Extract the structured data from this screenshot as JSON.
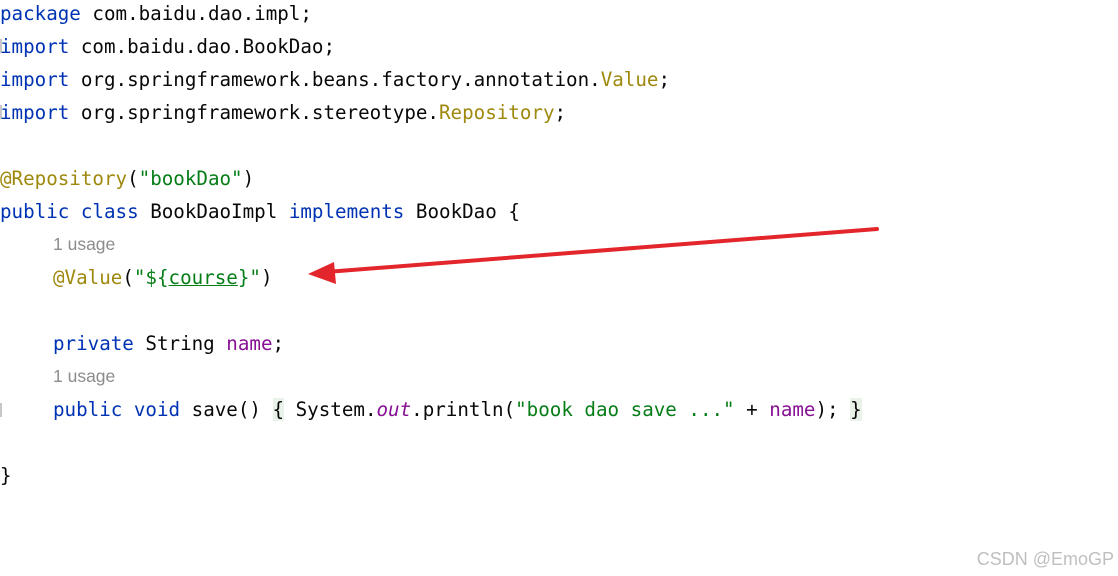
{
  "code": {
    "package_kw": "package",
    "package_name": " com.baidu.dao.impl;",
    "imports": [
      {
        "kw": "import",
        "path": " com.baidu.dao.BookDao;",
        "cls": "",
        "tail": ""
      },
      {
        "kw": "import",
        "path": " org.springframework.beans.factory.annotation.",
        "cls": "Value",
        "tail": ";"
      },
      {
        "kw": "import",
        "path": " org.springframework.stereotype.",
        "cls": "Repository",
        "tail": ";"
      }
    ],
    "class_annotation": "@Repository",
    "class_annotation_open": "(",
    "class_annotation_arg": "\"bookDao\"",
    "class_annotation_close": ")",
    "class_mod1": "public",
    "class_mod2": "class",
    "class_name": " BookDaoImpl ",
    "implements_kw": "implements",
    "interface_name": " BookDao {",
    "usage_hint_1": "1 usage",
    "field_annotation": "@Value",
    "field_annotation_open": "(",
    "field_annotation_str_a": "\"${",
    "field_annotation_str_key": "course",
    "field_annotation_str_b": "}\"",
    "field_annotation_close": ")",
    "field_mod": "private",
    "field_type": " String ",
    "field_name": "name",
    "field_semicolon": ";",
    "usage_hint_2": "1 usage",
    "method_mod": "public",
    "method_ret": "void",
    "method_name": " save() ",
    "method_open": "{",
    "method_body_a": " System.",
    "method_body_out": "out",
    "method_body_b": ".println(",
    "method_body_str": "\"book dao save ...\"",
    "method_body_plus": " + ",
    "method_body_field": "name",
    "method_body_end": "); ",
    "method_close": "}",
    "class_close": "}"
  },
  "annotation_arrow": {
    "color": "#e3262b"
  },
  "watermark": "CSDN @EmoGP"
}
